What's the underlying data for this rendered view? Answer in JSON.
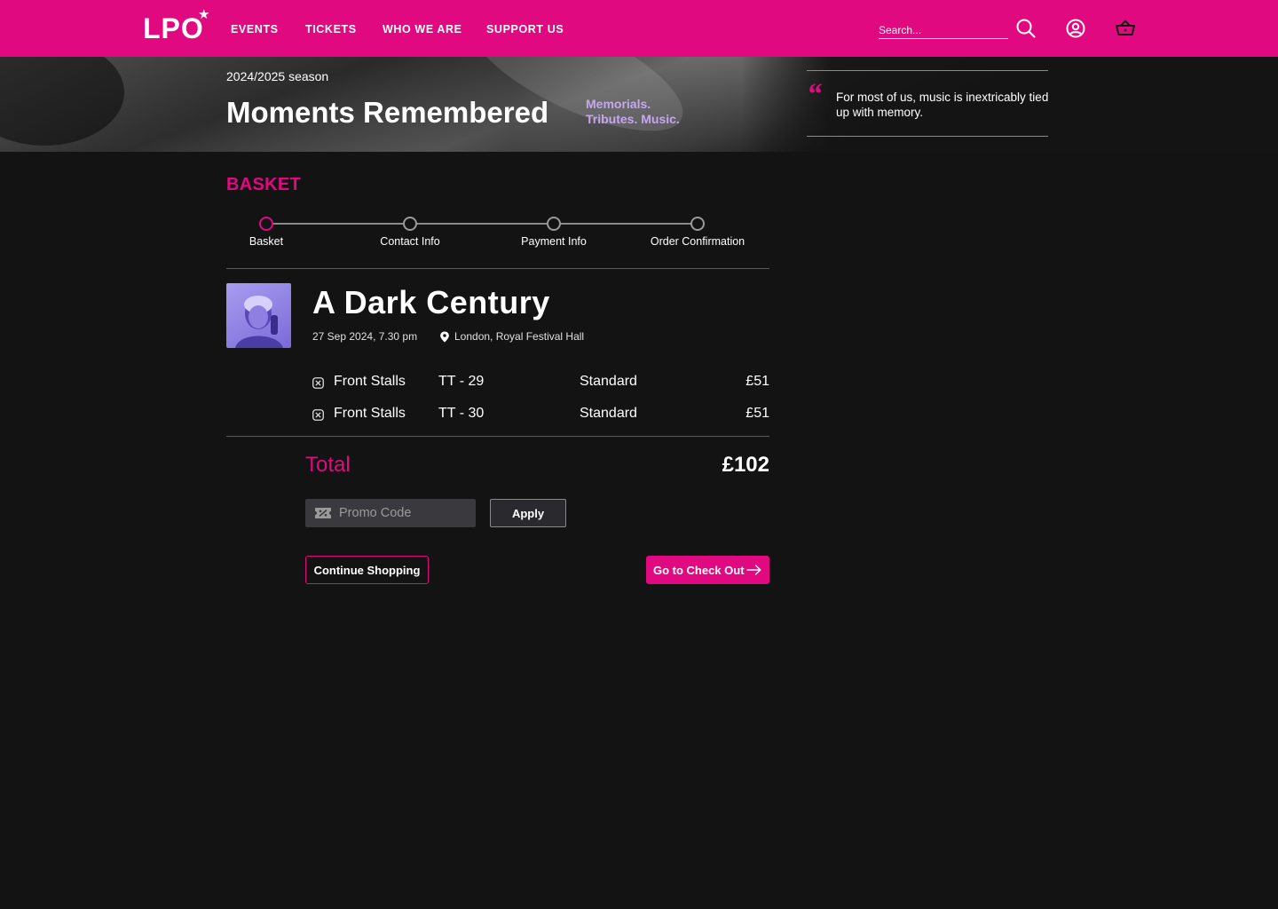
{
  "nav": {
    "logo": "LPO",
    "links": [
      "EVENTS",
      "TICKETS",
      "WHO WE ARE",
      "SUPPORT US"
    ],
    "search_placeholder": "Search...",
    "icons": [
      "search-icon",
      "account-icon",
      "basket-icon"
    ]
  },
  "hero": {
    "season": "2024/2025 season",
    "title": "Moments Remembered",
    "tagline_line1": "Memorials.",
    "tagline_line2": "Tributes. Music.",
    "quote": "For most of us, music is inextricably tied up with memory."
  },
  "basket": {
    "heading": "BASKET",
    "steps": [
      "Basket",
      "Contact Info",
      "Payment Info",
      "Order Confirmation"
    ],
    "active_step": 0,
    "item": {
      "title": "A Dark Century",
      "date": "27 Sep 2024, 7.30 pm",
      "venue": "London, Royal Festival Hall",
      "tickets": [
        {
          "section": "Front Stalls",
          "seat": "TT - 29",
          "type": "Standard",
          "price": "£51"
        },
        {
          "section": "Front Stalls",
          "seat": "TT - 30",
          "type": "Standard",
          "price": "£51"
        }
      ]
    },
    "total_label": "Total",
    "total_value": "£102",
    "promo_placeholder": "Promo Code",
    "apply_label": "Apply",
    "continue_label": "Continue Shopping",
    "checkout_label": "Go to Check Out"
  },
  "colors": {
    "brand": "#e0097f",
    "background": "#131313",
    "accent_lilac": "#c7a6f0"
  }
}
